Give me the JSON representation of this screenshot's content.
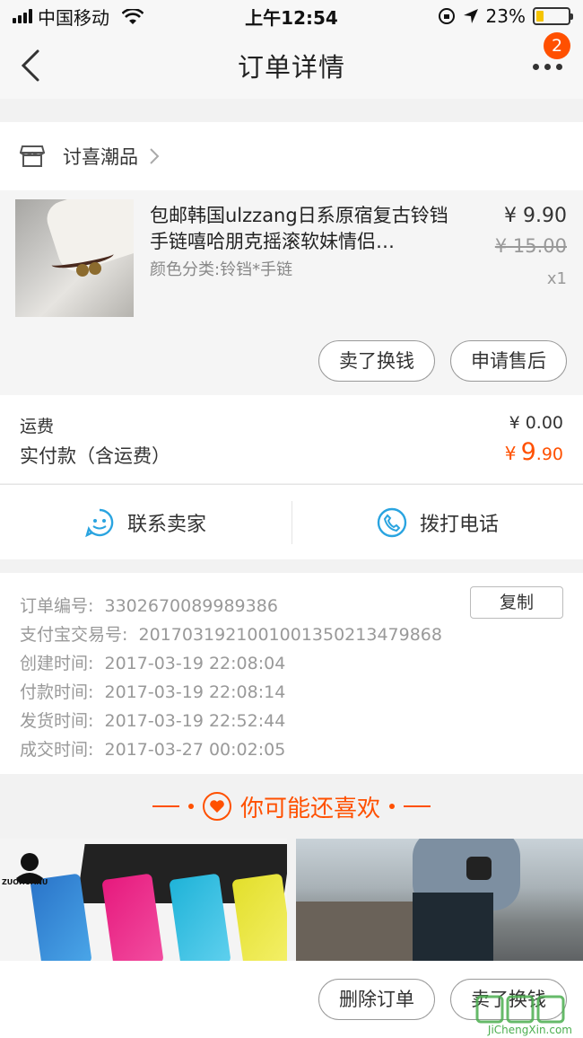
{
  "status_bar": {
    "carrier": "中国移动",
    "time": "上午12:54",
    "battery": "23%",
    "battery_level": 0.23
  },
  "nav": {
    "title": "订单详情",
    "badge": "2"
  },
  "shop": {
    "name": "讨喜潮品"
  },
  "product": {
    "title": "包邮韩国ulzzang日系原宿复古铃铛手链嘻哈朋克摇滚软妹情侣…",
    "sku": "颜色分类:铃铛*手链",
    "price": "¥ 9.90",
    "original_price": "¥ 15.00",
    "quantity": "x1",
    "buttons": {
      "resell": "卖了换钱",
      "after_sale": "申请售后"
    }
  },
  "fees": {
    "shipping_label": "运费",
    "shipping_value": "¥ 0.00",
    "paid_label": "实付款（含运费）",
    "paid_currency": "¥",
    "paid_int": "9",
    "paid_dec": ".90"
  },
  "contact": {
    "seller": "联系卖家",
    "phone": "拨打电话"
  },
  "order_info": {
    "copy": "复制",
    "rows": [
      {
        "label": "订单编号:",
        "value": "3302670089989386"
      },
      {
        "label": "支付宝交易号:",
        "value": "2017031921001001350213479868"
      },
      {
        "label": "创建时间:",
        "value": "2017-03-19 22:08:04"
      },
      {
        "label": "付款时间:",
        "value": "2017-03-19 22:08:14"
      },
      {
        "label": "发货时间:",
        "value": "2017-03-19 22:52:44"
      },
      {
        "label": "成交时间:",
        "value": "2017-03-27 00:02:05"
      }
    ]
  },
  "recommend": {
    "title": "你可能还喜欢",
    "brand": "ZUOHUANU"
  },
  "bottom": {
    "delete": "删除订单",
    "resell": "卖了换钱"
  },
  "watermark": "JiChengXin.com",
  "colors": {
    "accent": "#ff5000",
    "bg": "#f2f2f2"
  }
}
